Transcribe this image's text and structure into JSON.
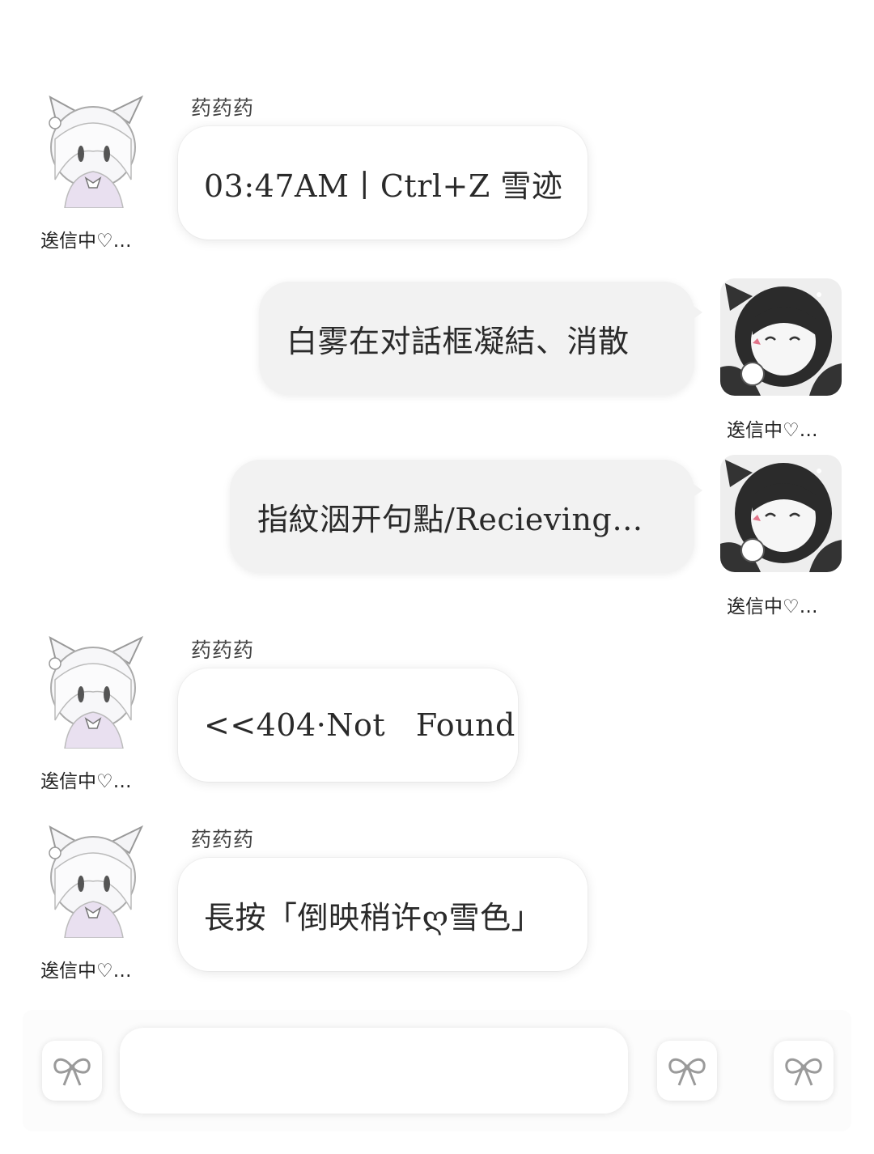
{
  "messages": [
    {
      "sender": "药药药",
      "text": "03:47AM丨Ctrl+Z 雪迹",
      "status": "逘信中♡…"
    },
    {
      "text": "白雾在对話框凝結、消散",
      "status": "逘信中♡…"
    },
    {
      "text": "指紋洇开句點/Recieving…",
      "status": "逘信中♡…"
    },
    {
      "sender": "药药药",
      "text": "<<404·Not   Found",
      "status": "逘信中♡…"
    },
    {
      "sender": "药药药",
      "text": "長按「倒映稍许ღ雪色」",
      "status": "逘信中♡…"
    }
  ],
  "input": {
    "value": "",
    "placeholder": ""
  },
  "icons": {
    "left_avatar": "white-haired-cat-girl-avatar",
    "right_avatar": "dark-haired-cat-girl-avatar",
    "bottom_buttons": [
      "bow-icon",
      "bow-icon",
      "bow-icon"
    ]
  },
  "colors": {
    "background": "#ffffff",
    "incoming_bubble": "#ffffff",
    "outgoing_bubble": "#f2f2f2",
    "text": "#2a2a2a"
  }
}
